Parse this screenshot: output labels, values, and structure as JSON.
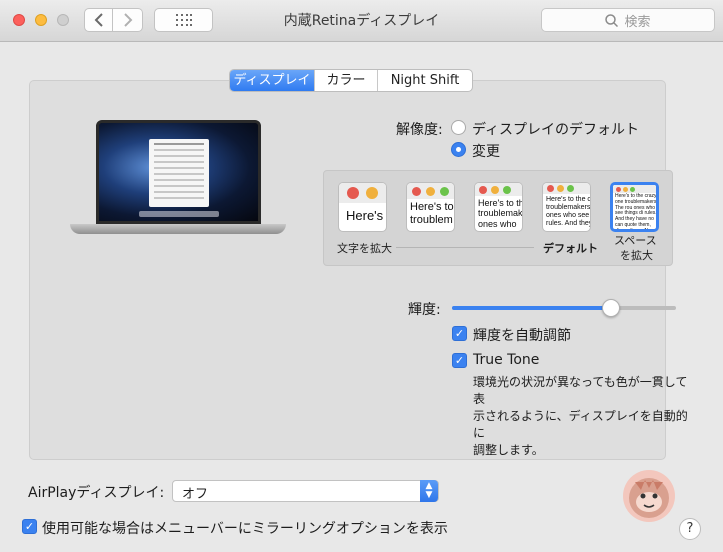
{
  "window": {
    "title": "内蔵Retinaディスプレイ"
  },
  "search": {
    "placeholder": "検索"
  },
  "tabs": [
    {
      "label": "ディスプレイ",
      "active": true
    },
    {
      "label": "カラー",
      "active": false
    },
    {
      "label": "Night Shift",
      "active": false
    }
  ],
  "resolution": {
    "label": "解像度:",
    "options": [
      {
        "label": "ディスプレイのデフォルト",
        "selected": false
      },
      {
        "label": "変更",
        "selected": true
      }
    ]
  },
  "scaled": {
    "preview_texts": [
      "Here's",
      "Here's to troublem",
      "Here's to th troublemak ones who",
      "Here's to the cr troublemakers. ones who see t rules. And they",
      "Here's to the crazy one troublemakers. The rou ones who see things di rules. And they have no can quote them, disagr them. About the only th Because they change t"
    ],
    "left_caption": "文字を拡大",
    "default_caption": "デフォルト",
    "right_caption_1": "スペース",
    "right_caption_2": "を拡大",
    "selected_index": 4
  },
  "brightness": {
    "label": "輝度:",
    "value": 0.71,
    "auto_label": "輝度を自動調節",
    "auto_checked": true
  },
  "true_tone": {
    "label": "True Tone",
    "checked": true,
    "desc_1": "環境光の状況が異なっても色が一貫して表",
    "desc_2": "示されるように、ディスプレイを自動的に",
    "desc_3": "調整します。"
  },
  "airplay": {
    "label": "AirPlayディスプレイ:",
    "value": "オフ"
  },
  "mirroring": {
    "label": "使用可能な場合はメニューバーにミラーリングオプションを表示",
    "checked": true
  },
  "help": {
    "label": "?"
  },
  "colors": {
    "accent": "#3b82f0",
    "close": "#fc605c",
    "minimize": "#fdbc40",
    "zoom": "#c8c8c8"
  }
}
